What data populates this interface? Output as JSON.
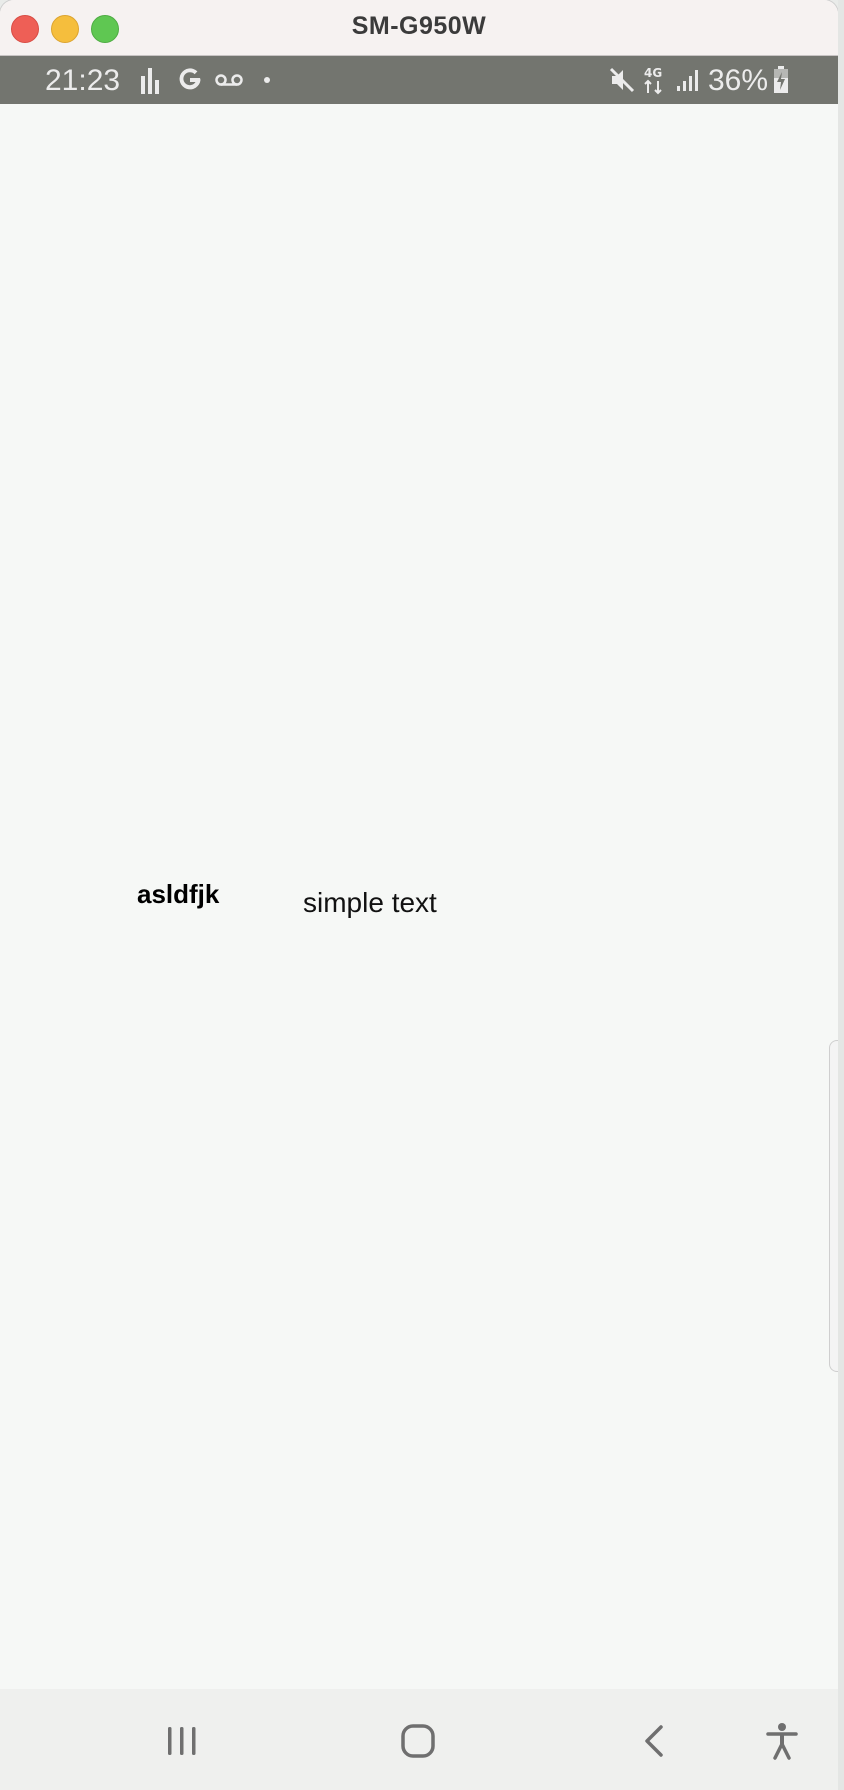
{
  "window": {
    "title": "SM-G950W"
  },
  "status_bar": {
    "time": "21:23",
    "battery_percent": "36%",
    "network": "4G",
    "left_icons": [
      "bar-chart-icon",
      "google-g-icon",
      "voicemail-icon",
      "dot-icon"
    ],
    "right_icons": [
      "mute-icon",
      "4g-data-icon",
      "signal-icon",
      "battery-charging-icon"
    ]
  },
  "content": {
    "bold_text": "asldfjk",
    "plain_text": "simple text"
  },
  "nav_bar": {
    "buttons": [
      "recents-icon",
      "home-icon",
      "back-icon",
      "accessibility-icon"
    ]
  },
  "colors": {
    "status_bar_bg": "#73756f",
    "content_bg": "#f6f8f6",
    "nav_bar_bg": "#eff0ee",
    "close": "#ee5f56",
    "minimize": "#f5be3d",
    "maximize": "#5fc752"
  }
}
